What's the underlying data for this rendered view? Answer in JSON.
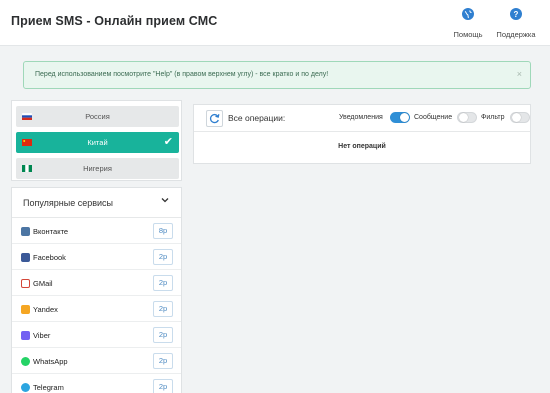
{
  "header": {
    "title": "Прием SMS - Онлайн прием СМС",
    "nav": [
      {
        "label": "Помощь",
        "icon": "globe-icon"
      },
      {
        "label": "Поддержка",
        "icon": "question-icon"
      }
    ]
  },
  "alert": {
    "text": "Перед использованием посмотрите \"Help\" (в правом верхнем углу) - все кратко и по делу!",
    "close": "×"
  },
  "countries": {
    "items": [
      {
        "name": "Россия",
        "selected": false
      },
      {
        "name": "Китай",
        "selected": true,
        "check": "✔"
      },
      {
        "name": "Нигерия",
        "selected": false
      }
    ]
  },
  "services": {
    "header": "Популярные сервисы",
    "chevron": "⌄",
    "items": [
      {
        "name": "Вконтакте",
        "price": "8р",
        "icon": "vk-icon",
        "color": "#4c75a3"
      },
      {
        "name": "Facebook",
        "price": "2р",
        "icon": "facebook-icon",
        "color": "#3b5998"
      },
      {
        "name": "GMail",
        "price": "2р",
        "icon": "gmail-icon",
        "color": "#d44638"
      },
      {
        "name": "Yandex",
        "price": "2р",
        "icon": "yandex-icon",
        "color": "#f5a623"
      },
      {
        "name": "Viber",
        "price": "2р",
        "icon": "viber-icon",
        "color": "#7360f2"
      },
      {
        "name": "WhatsApp",
        "price": "2р",
        "icon": "whatsapp-icon",
        "color": "#25d366"
      },
      {
        "name": "Telegram",
        "price": "2р",
        "icon": "telegram-icon",
        "color": "#2ca5e0"
      }
    ]
  },
  "operations": {
    "title": "Все операции:",
    "toggles": [
      {
        "label": "Уведомления",
        "on": true
      },
      {
        "label": "Сообщение",
        "on": false
      },
      {
        "label": "Фильтр",
        "on": false
      }
    ],
    "empty": "Нет операций"
  },
  "colors": {
    "accent": "#18b39b",
    "toggle_on": "#2f8fd6",
    "price_text": "#4d8ac2",
    "alert_bg": "#e9f6ef"
  }
}
